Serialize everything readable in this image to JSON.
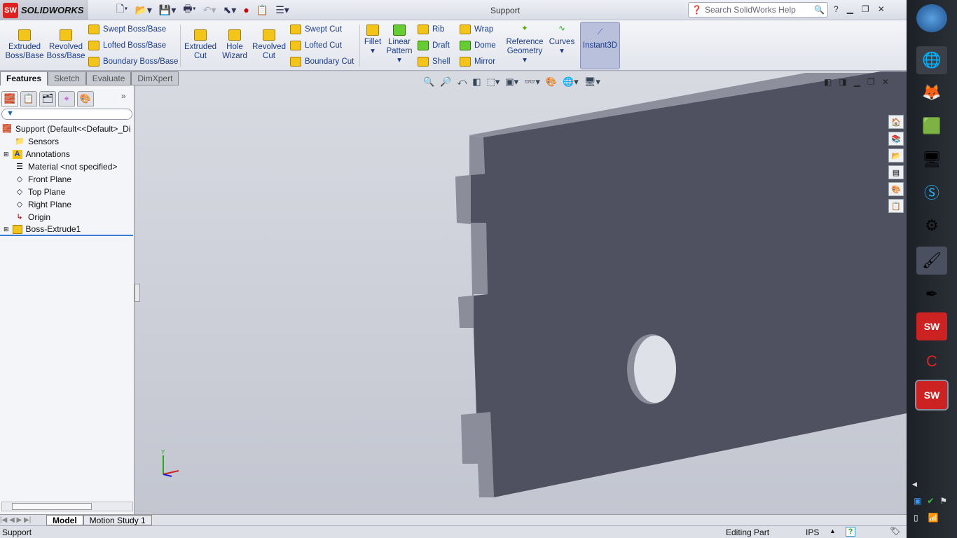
{
  "app": {
    "name": "SOLIDWORKS",
    "doc_title": "Support",
    "search_placeholder": "Search SolidWorks Help",
    "help": "?"
  },
  "ribbon": {
    "big": [
      {
        "label": "Extruded Boss/Base"
      },
      {
        "label": "Revolved Boss/Base"
      },
      {
        "label": "Extruded Cut"
      },
      {
        "label": "Hole Wizard"
      },
      {
        "label": "Revolved Cut"
      },
      {
        "label": "Fillet"
      },
      {
        "label": "Linear Pattern"
      },
      {
        "label": "Reference Geometry"
      },
      {
        "label": "Curves"
      },
      {
        "label": "Instant3D"
      }
    ],
    "small": [
      "Swept Boss/Base",
      "Lofted Boss/Base",
      "Boundary Boss/Base",
      "Swept Cut",
      "Lofted Cut",
      "Boundary Cut",
      "Rib",
      "Draft",
      "Shell",
      "Wrap",
      "Dome",
      "Mirror"
    ]
  },
  "command_tabs": [
    "Features",
    "Sketch",
    "Evaluate",
    "DimXpert"
  ],
  "feature_tree": {
    "filter_icon": "funnel-icon",
    "root": "Support  (Default<<Default>_Di",
    "items": [
      "Sensors",
      "Annotations",
      "Material <not specified>",
      "Front Plane",
      "Top Plane",
      "Right Plane",
      "Origin",
      "Boss-Extrude1"
    ]
  },
  "bottom_tabs": [
    "Model",
    "Motion Study 1"
  ],
  "status": {
    "left": "Support",
    "mode": "Editing Part",
    "units": "IPS"
  },
  "colors": {
    "part_front": "#4f5161",
    "part_side": "#8b8d9b",
    "accent": "#1a3b8a"
  }
}
